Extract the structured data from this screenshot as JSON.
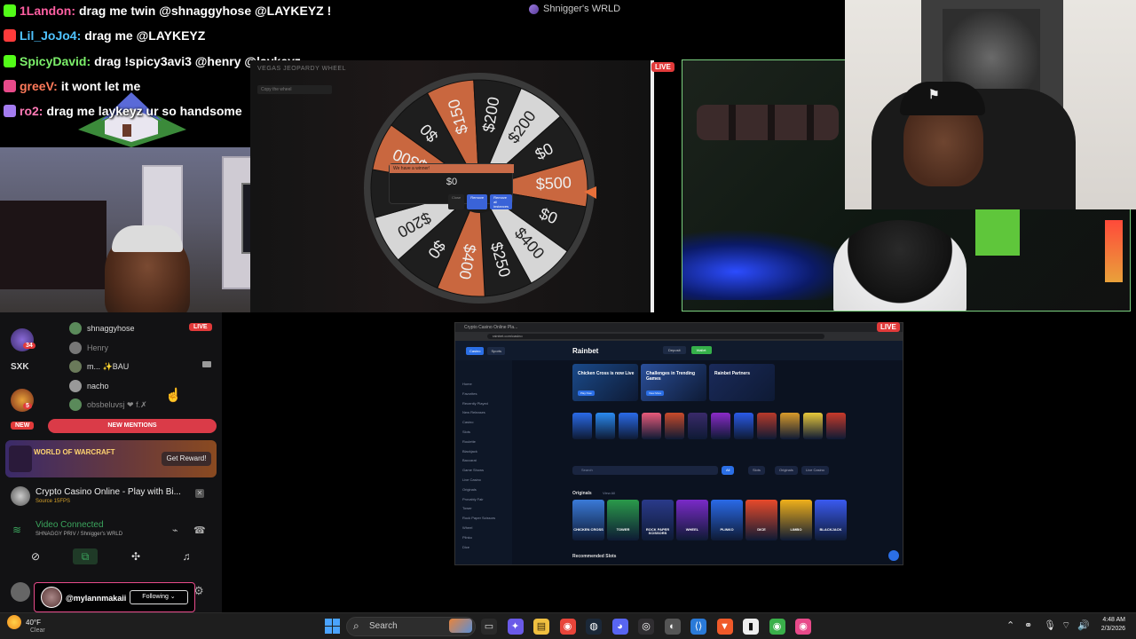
{
  "stream": {
    "title": "Shnigger's WRLD"
  },
  "chat": [
    {
      "user": "1Landon:",
      "message": "drag me twin @shnaggyhose @LAYKEYZ !",
      "user_color": "#ff5fa2",
      "badge_color": "#53fc18"
    },
    {
      "user": "Lil_JoJo4:",
      "message": "drag me @LAYKEYZ",
      "user_color": "#4fc3ff",
      "badge_color": "#ff3b3b"
    },
    {
      "user": "SpicyDavid:",
      "message": "drag !spicy3avi3 @henry @laykeyz",
      "user_color": "#7cf06a",
      "badge_color": "#53fc18"
    },
    {
      "user": "greeV:",
      "message": "it wont let me",
      "user_color": "#ff7a5a",
      "badge_color": "#e84a8a"
    },
    {
      "user": "ro2:",
      "message": "drag me laykeyz ur so handsome",
      "user_color": "#ff7ab6",
      "badge_color": "#a47cf0"
    }
  ],
  "wheel": {
    "title": "VEGAS JEOPARDY WHEEL",
    "toolbar": "Copy the wheel",
    "segments": [
      "$150",
      "$200",
      "$200",
      "$0",
      "$500",
      "$0",
      "$400",
      "$250",
      "$400",
      "$0",
      "$200",
      "$0",
      "$300",
      "$0"
    ],
    "dialog_title": "We have a winner!",
    "dialog_value": "$0",
    "dialog_buttons": [
      "Close",
      "Remove",
      "Remove all instances"
    ],
    "live": "LIVE"
  },
  "discord": {
    "sxk": "SXK",
    "rail_counts": [
      "34",
      "5"
    ],
    "rail_new": "NEW",
    "live": "LIVE",
    "voice_users": [
      {
        "name": "shnaggyhose",
        "dim": false
      },
      {
        "name": "Henry",
        "dim": true
      },
      {
        "name": "m... ✨BAU",
        "dim": false
      },
      {
        "name": "nacho",
        "dim": false
      },
      {
        "name": "obsbeluvsj ❤ f.✗",
        "dim": true
      }
    ],
    "new_mentions": "NEW MENTIONS",
    "promo_logo": "WORLD OF WARCRAFT",
    "promo_button": "Get Reward!",
    "activity_title": "Crypto Casino Online - Play with Bi...",
    "activity_sub": "Source 15FPS",
    "voice_status": "Video Connected",
    "voice_channel": "SHNAGGY PRIV / Shnigger's WRLD"
  },
  "follow_card": {
    "name": "@mylannmakaii",
    "button": "Following ⌄"
  },
  "browser": {
    "live": "LIVE",
    "tab_text": "Crypto Casino Online Pla...",
    "url": "rainbet.com/casino",
    "logo": "Rainbet",
    "site_tabs": [
      "Casino",
      "Sports"
    ],
    "header_buttons": [
      "Deposit",
      "Wallet"
    ],
    "sidebar_items": [
      "Home",
      "Favorites",
      "Recently Played",
      "New Releases",
      "Casino",
      "Slots",
      "Roulette",
      "Blackjack",
      "Baccarat",
      "Game Shows",
      "Live Casino",
      "Originals",
      "Provably Fair",
      "Tower",
      "Rock Paper Scissors",
      "Wheel",
      "Plinko",
      "Dice"
    ],
    "banners": [
      {
        "title": "Chicken Cross is now Live",
        "button": "Play Now",
        "color": "#1a4a8a"
      },
      {
        "title": "Challenges in Trending Games",
        "button": "View More",
        "color": "#2a4f9a"
      },
      {
        "title": "Rainbet Partners",
        "button": "",
        "color": "#1a2a5a"
      }
    ],
    "search_placeholder": "Search",
    "filters": [
      "All",
      "Slots",
      "Originals",
      "Live Casino"
    ],
    "originals_title": "Originals",
    "originals_viewall": "View All",
    "originals": [
      {
        "label": "CHICKEN CROSS",
        "color": "#3a7ad8"
      },
      {
        "label": "TOWER",
        "color": "#2a9a4a"
      },
      {
        "label": "ROCK PAPER SCISSORS",
        "color": "#2a3a8a"
      },
      {
        "label": "WHEEL",
        "color": "#7a2ac8"
      },
      {
        "label": "PLINKO",
        "color": "#2a6ae8"
      },
      {
        "label": "DICE",
        "color": "#e84a2a"
      },
      {
        "label": "LIMBO",
        "color": "#f0b01a"
      },
      {
        "label": "BLACKJACK",
        "color": "#3a5af0"
      }
    ],
    "recommended_title": "Recommended Slots",
    "game_colors": [
      "#2a6ae8",
      "#2a8af0",
      "#2a6ae8",
      "#e85a7a",
      "#c84a2a",
      "#3a2a6a",
      "#8a2ac8",
      "#2a5ae8",
      "#b83a2a",
      "#d89a2a",
      "#e8c83a",
      "#c83a2a"
    ]
  },
  "taskbar": {
    "temp": "40°F",
    "condition": "Clear",
    "search": "Search",
    "time": "4:48 AM",
    "date": "2/3/2026"
  }
}
